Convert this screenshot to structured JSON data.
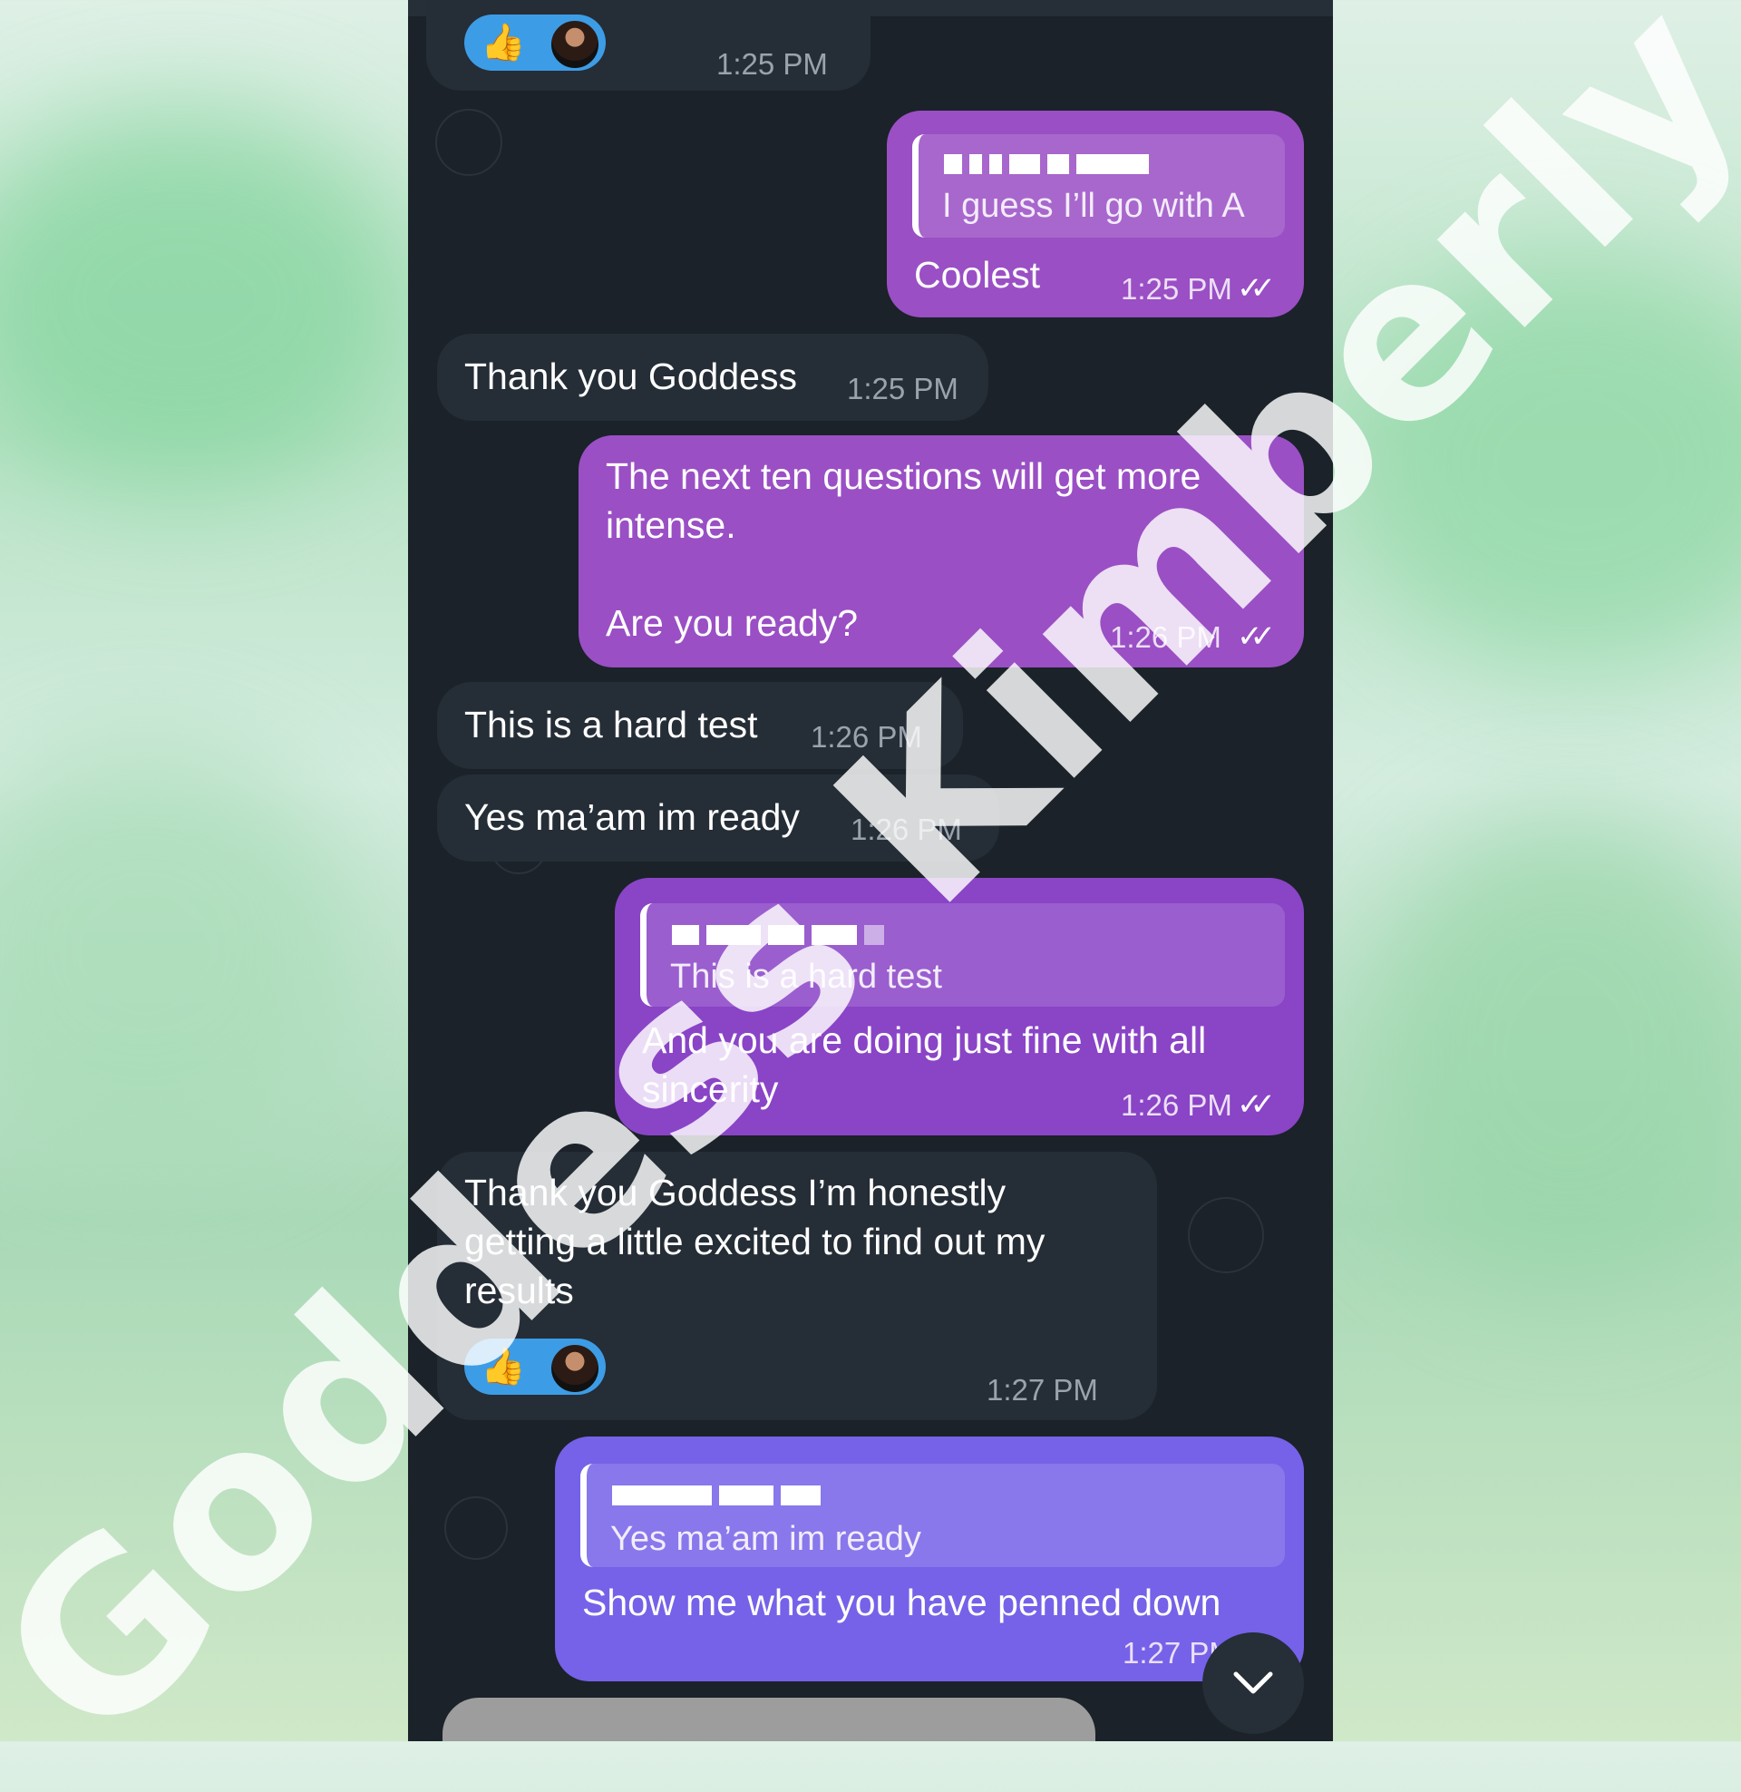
{
  "messages": [
    {
      "id": "m1",
      "direction": "incoming",
      "time": "1:25 PM",
      "reaction": {
        "emoji": "👍",
        "icon": "thumbs-up-icon"
      }
    },
    {
      "id": "m2",
      "direction": "outgoing",
      "quote_text": "I guess I’ll go with A",
      "text": "Coolest",
      "time": "1:25 PM",
      "status": "read"
    },
    {
      "id": "m3",
      "direction": "incoming",
      "text": "Thank you Goddess",
      "time": "1:25 PM"
    },
    {
      "id": "m4",
      "direction": "outgoing",
      "text": "The next ten questions will get more\nintense.\n\nAre you ready?",
      "time": "1:26 PM",
      "status": "read"
    },
    {
      "id": "m5",
      "direction": "incoming",
      "text": "This is a hard test",
      "time": "1:26 PM"
    },
    {
      "id": "m6",
      "direction": "incoming",
      "text": "Yes ma’am im ready",
      "time": "1:26 PM"
    },
    {
      "id": "m7",
      "direction": "outgoing",
      "quote_text": "This is a hard test",
      "text": "And you are doing just fine with all\nsincerity",
      "time": "1:26 PM",
      "status": "read"
    },
    {
      "id": "m8",
      "direction": "incoming",
      "text": "Thank you Goddess I’m honestly\ngetting a little excited to find out my\nresults",
      "time": "1:27 PM",
      "reaction": {
        "emoji": "👍",
        "icon": "thumbs-up-icon"
      }
    },
    {
      "id": "m9",
      "direction": "outgoing",
      "quote_text": "Yes ma’am im ready",
      "text": "Show me what you have penned down",
      "time": "1:27 PM",
      "status": "read"
    }
  ],
  "read_checks": "✓✓",
  "watermark": "Goddess Kimberly",
  "scroll_button": {
    "icon": "chevron-down-icon"
  },
  "colors": {
    "incoming": "#252d36",
    "outgoing_purple": "#9a4fc4",
    "outgoing_violet": "#8a44c6",
    "outgoing_blue": "#7562e8",
    "chat_bg": "#1b2229"
  }
}
